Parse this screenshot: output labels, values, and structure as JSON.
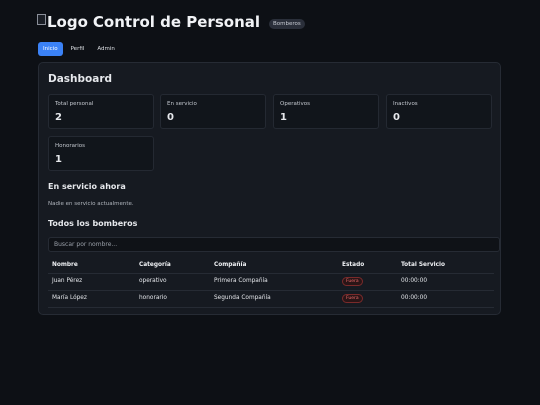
{
  "header": {
    "logo_alt": "Logo",
    "title": "Control de Personal",
    "badge": "Bomberos"
  },
  "nav": {
    "tabs": [
      {
        "label": "Inicio",
        "active": true
      },
      {
        "label": "Perfil",
        "active": false
      },
      {
        "label": "Admin",
        "active": false
      }
    ]
  },
  "dashboard": {
    "title": "Dashboard",
    "cards": [
      {
        "label": "Total personal",
        "value": "2"
      },
      {
        "label": "En servicio",
        "value": "0"
      },
      {
        "label": "Operativos",
        "value": "1"
      },
      {
        "label": "Inactivos",
        "value": "0"
      },
      {
        "label": "Honorarios",
        "value": "1"
      }
    ]
  },
  "on_duty": {
    "title": "En servicio ahora",
    "empty_text": "Nadie en servicio actualmente."
  },
  "all": {
    "title": "Todos los bomberos",
    "search_placeholder": "Buscar por nombre...",
    "columns": [
      "Nombre",
      "Categoría",
      "Compañía",
      "Estado",
      "Total Servicio"
    ],
    "rows": [
      {
        "name": "Juan Pérez",
        "category": "operativo",
        "company": "Primera Compañía",
        "status": "Fuera",
        "total": "00:00:00"
      },
      {
        "name": "María López",
        "category": "honorario",
        "company": "Segunda Compañía",
        "status": "Fuera",
        "total": "00:00:00"
      }
    ]
  },
  "colors": {
    "accent": "#3b82f6",
    "status_out": "#ef6b6b",
    "background": "#0d1015",
    "panel": "#161a21"
  }
}
